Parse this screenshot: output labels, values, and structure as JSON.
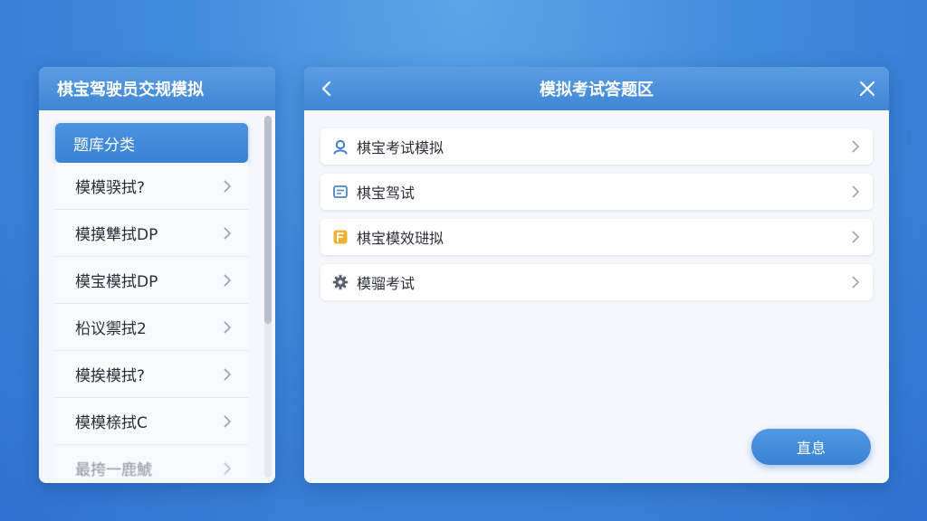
{
  "left_panel": {
    "title": "棋宝驾驶员交规模拟",
    "active_category": "题库分类",
    "items": [
      {
        "label": "模模骙拭?"
      },
      {
        "label": "模摸犨拭DP"
      },
      {
        "label": "模宝模拭DP"
      },
      {
        "label": "柗议禦拭2"
      },
      {
        "label": "模挨模拭?"
      },
      {
        "label": "模模榇拭C"
      },
      {
        "label": "最挎一鹿鯱"
      }
    ]
  },
  "right_panel": {
    "title": "模拟考试答题区",
    "items": [
      {
        "label": "棋宝考试模拟",
        "icon": "user-icon",
        "color": "#3f7fd0"
      },
      {
        "label": "棋宝驾试",
        "icon": "message-icon",
        "color": "#4f86c9"
      },
      {
        "label": "棋宝模效琎拟",
        "icon": "document-icon",
        "color": "#f0b030"
      },
      {
        "label": "模骝考试",
        "icon": "gear-icon",
        "color": "#5a6270"
      }
    ],
    "confirm_label": "直息"
  },
  "colors": {
    "accent": "#3f86d6",
    "background": "#3f8bdc",
    "panel": "#f4f7fb"
  }
}
